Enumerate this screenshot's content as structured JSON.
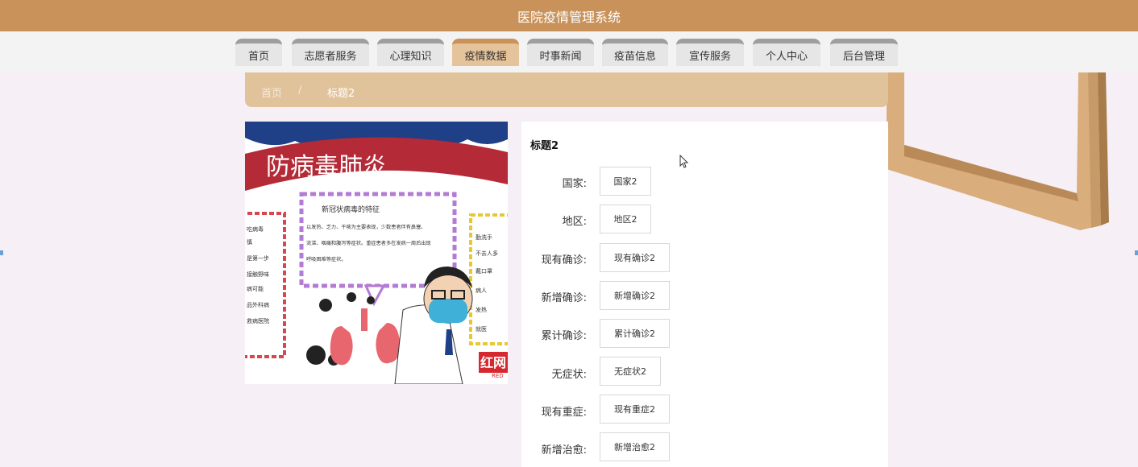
{
  "app": {
    "title": "医院疫情管理系统"
  },
  "nav": {
    "items": [
      "首页",
      "志愿者服务",
      "心理知识",
      "疫情数据",
      "时事新闻",
      "疫苗信息",
      "宣传服务",
      "个人中心",
      "后台管理"
    ],
    "active": "疫情数据"
  },
  "breadcrumb": {
    "home": "首页",
    "separator": "/",
    "current": "标题2"
  },
  "poster": {
    "banner": "防病毒肺炎",
    "card_heading": "新冠状病毒的特征",
    "card_text": [
      "以发热、乏力、干咳为主要表现，少数患者伴有鼻塞、",
      "流涕、咽痛和腹泻等症状。重症患者多在发病一周后出现",
      "呼吸困难等症状。"
    ],
    "left_note": [
      "吃病毒",
      "慎",
      "是第一步",
      "接触野味",
      "病可能",
      "品外科病",
      "救病医院"
    ],
    "right_note": [
      "勤洗手",
      "不去人多",
      "戴口罩",
      "病人",
      "发热",
      "就医"
    ],
    "watermark": "红网",
    "watermark_sub": "RED"
  },
  "detail": {
    "title": "标题2",
    "fields": [
      {
        "label": "国家:",
        "value": "国家2"
      },
      {
        "label": "地区:",
        "value": "地区2"
      },
      {
        "label": "现有确诊:",
        "value": "现有确诊2"
      },
      {
        "label": "新增确诊:",
        "value": "新增确诊2"
      },
      {
        "label": "累计确诊:",
        "value": "累计确诊2"
      },
      {
        "label": "无症状:",
        "value": "无症状2"
      },
      {
        "label": "现有重症:",
        "value": "现有重症2"
      },
      {
        "label": "新增治愈:",
        "value": "新增治愈2"
      }
    ]
  },
  "colors": {
    "header": "#c9925a",
    "nav_active": "#e6c49b",
    "breadcrumb": "#e1c39b",
    "page_bg": "#f6eff5"
  }
}
